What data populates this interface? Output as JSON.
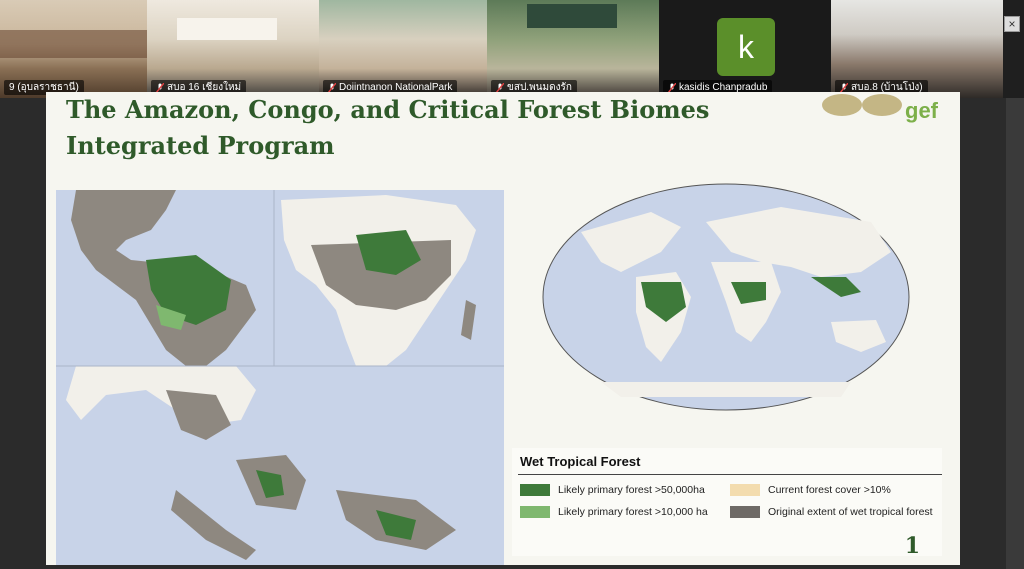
{
  "participants": [
    {
      "name": "9 (อุบลราชธานี)",
      "muted": false
    },
    {
      "name": "สบอ 16 เชียงใหม่",
      "muted": true
    },
    {
      "name": "Doiintnanon NationalPark",
      "muted": true
    },
    {
      "name": "ขสป.พนมดงรัก",
      "muted": true
    },
    {
      "name": "kasidis Chanpradub",
      "muted": true,
      "avatar_letter": "k"
    },
    {
      "name": "สบอ.8 (บ้านโป่ง)",
      "muted": true
    }
  ],
  "slide": {
    "title_line1": "The Amazon, Congo, and Critical Forest Biomes",
    "title_line2": "Integrated Program",
    "logo_text": "gef",
    "page_number": "1",
    "legend": {
      "title": "Wet Tropical Forest",
      "items": [
        {
          "label": "Likely primary forest >50,000ha",
          "color": "#3e7a3a"
        },
        {
          "label": "Current forest cover >10%",
          "color": "#f3dcae"
        },
        {
          "label": "Likely primary forest >10,000 ha",
          "color": "#7fb86f"
        },
        {
          "label": "Original extent of wet tropical forest",
          "color": "#6e6a66"
        }
      ]
    }
  },
  "colors": {
    "title": "#2f5a2a",
    "ocean": "#c8d3e8",
    "land": "#f2f0ea",
    "mute_red": "#e04040"
  }
}
